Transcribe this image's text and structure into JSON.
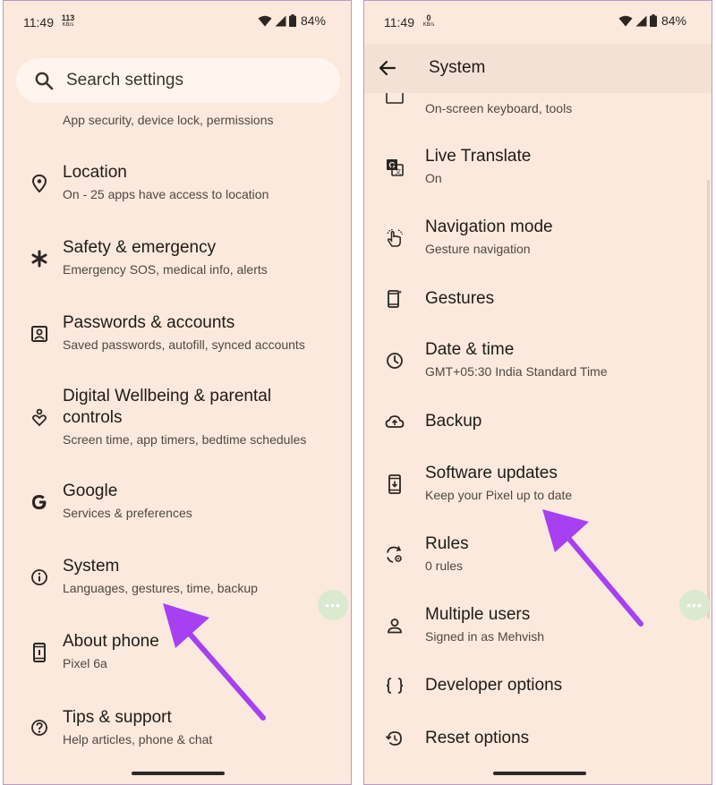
{
  "left_screen": {
    "status": {
      "time": "11:49",
      "speed_value": "113",
      "speed_unit": "KB/s",
      "battery": "84%"
    },
    "search": {
      "placeholder": "Search settings"
    },
    "partial_item_subtitle": "App security, device lock, permissions",
    "items": [
      {
        "title": "Location",
        "subtitle": "On - 25 apps have access to location",
        "icon": "location-pin-icon"
      },
      {
        "title": "Safety & emergency",
        "subtitle": "Emergency SOS, medical info, alerts",
        "icon": "asterisk-icon"
      },
      {
        "title": "Passwords & accounts",
        "subtitle": "Saved passwords, autofill, synced accounts",
        "icon": "account-box-icon"
      },
      {
        "title_line1": "Digital Wellbeing & parental",
        "title_line2": "controls",
        "subtitle": "Screen time, app timers, bedtime schedules",
        "icon": "wellbeing-icon"
      },
      {
        "title": "Google",
        "subtitle": "Services & preferences",
        "icon": "google-g-icon"
      },
      {
        "title": "System",
        "subtitle": "Languages, gestures, time, backup",
        "icon": "info-icon"
      },
      {
        "title": "About phone",
        "subtitle": "Pixel 6a",
        "icon": "phone-icon"
      },
      {
        "title": "Tips & support",
        "subtitle": "Help articles, phone & chat",
        "icon": "help-icon"
      }
    ]
  },
  "right_screen": {
    "status": {
      "time": "11:49",
      "speed_value": "0",
      "speed_unit": "KB/s",
      "battery": "84%"
    },
    "header": {
      "title": "System"
    },
    "partial_item_subtitle": "On-screen keyboard, tools",
    "items": [
      {
        "title": "Live Translate",
        "subtitle": "On",
        "icon": "translate-icon"
      },
      {
        "title": "Navigation mode",
        "subtitle": "Gesture navigation",
        "icon": "gesture-hand-icon"
      },
      {
        "title": "Gestures",
        "subtitle": "",
        "icon": "gestures-phone-icon"
      },
      {
        "title": "Date & time",
        "subtitle": "GMT+05:30 India Standard Time",
        "icon": "clock-icon"
      },
      {
        "title": "Backup",
        "subtitle": "",
        "icon": "cloud-upload-icon"
      },
      {
        "title": "Software updates",
        "subtitle": "Keep your Pixel up to date",
        "icon": "system-update-icon"
      },
      {
        "title": "Rules",
        "subtitle": "0 rules",
        "icon": "rules-icon"
      },
      {
        "title": "Multiple users",
        "subtitle": "Signed in as Mehvish",
        "icon": "person-icon"
      },
      {
        "title": "Developer options",
        "subtitle": "",
        "icon": "braces-icon"
      },
      {
        "title": "Reset options",
        "subtitle": "",
        "icon": "history-icon"
      }
    ]
  },
  "colors": {
    "background": "#fbe9dd",
    "accent_arrow": "#a640f0",
    "bubble": "#d9ead0"
  }
}
